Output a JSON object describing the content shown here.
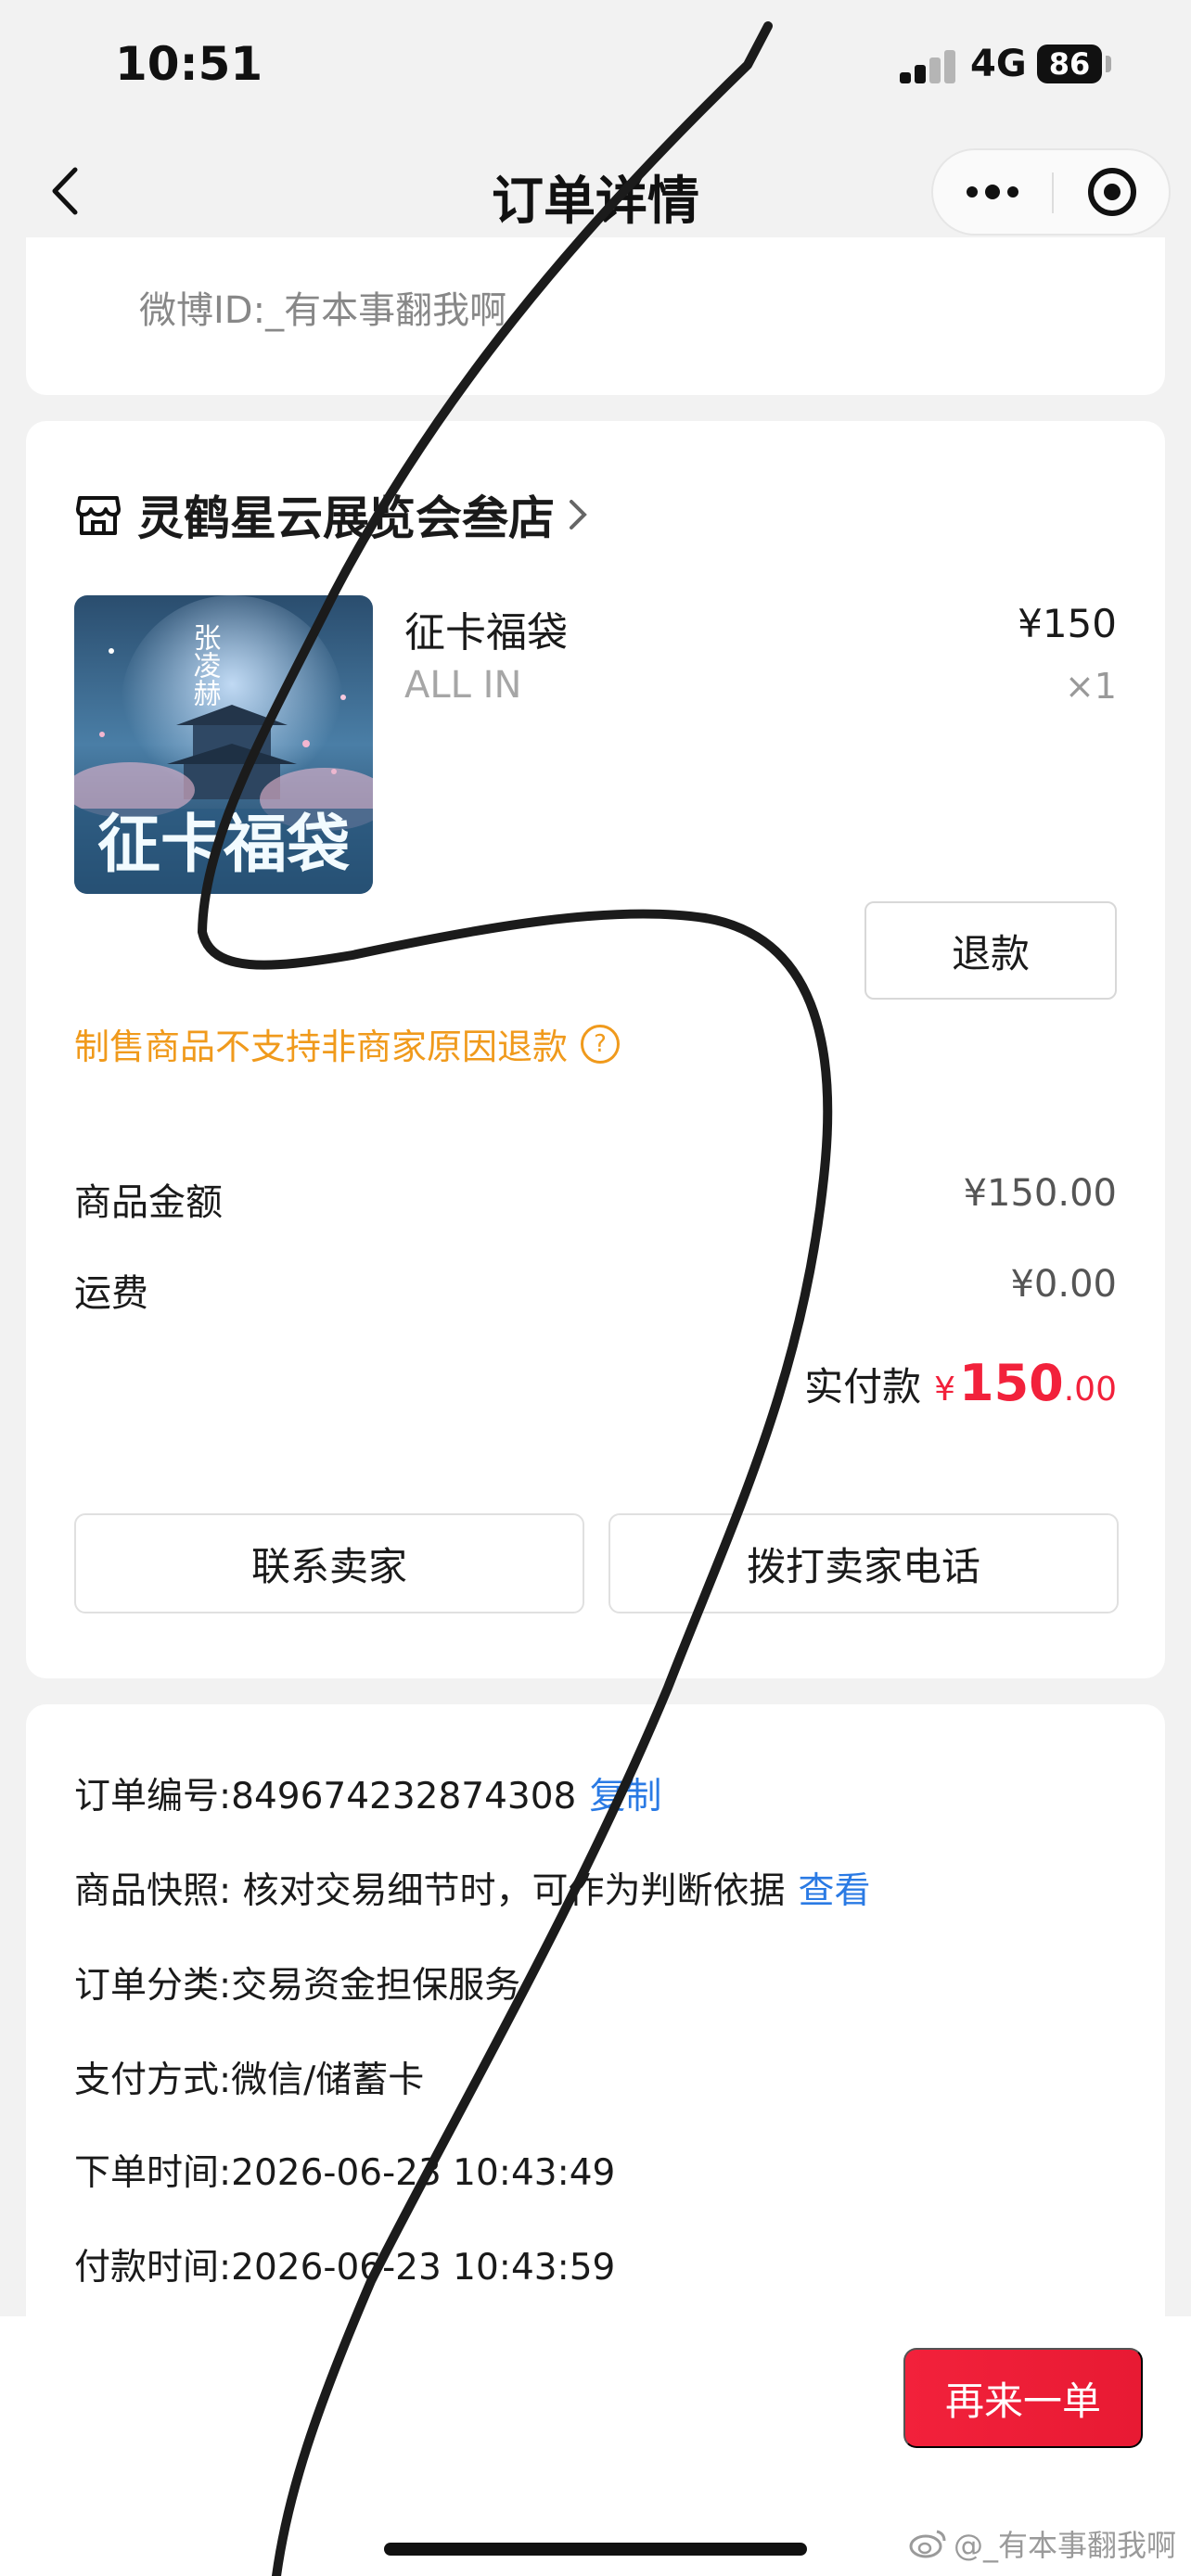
{
  "status_bar": {
    "time": "10:51",
    "network": "4G",
    "battery": "86"
  },
  "nav": {
    "title": "订单详情",
    "back_icon": "chevron-left-icon",
    "more_icon": "more-dots-icon",
    "close_icon": "target-close-icon"
  },
  "buyer": {
    "weibo_id": "微博ID:_有本事翻我啊"
  },
  "shop": {
    "name": "灵鹤星云展览会叁店",
    "icon": "store-icon"
  },
  "product": {
    "name": "征卡福袋",
    "sku": "ALL IN",
    "price": "¥150",
    "quantity": "×1",
    "image_text_main": "征卡福袋",
    "image_text_vertical": "张凌赫",
    "refund_label": "退款",
    "notice": "制售商品不支持非商家原因退款",
    "help_icon": "question-circle-icon"
  },
  "fees": {
    "goods_label": "商品金额",
    "goods_value": "¥150.00",
    "shipping_label": "运费",
    "shipping_value": "¥0.00",
    "paid_label": "实付款",
    "paid_currency": "¥",
    "paid_integer": "150",
    "paid_decimal": ".00"
  },
  "actions": {
    "contact_seller": "联系卖家",
    "call_seller": "拨打卖家电话"
  },
  "order_info": {
    "order_no": "订单编号:849674232874308",
    "copy": "复制",
    "snapshot": "商品快照: 核对交易细节时，可作为判断依据",
    "snapshot_link": "查看",
    "category": "订单分类:交易资金担保服务",
    "payment": "支付方式:微信/储蓄卡",
    "order_time": "下单时间:2026-06-23 10:43:49",
    "pay_time": "付款时间:2026-06-23 10:43:59"
  },
  "bottom": {
    "reorder": "再来一单",
    "watermark": "@_有本事翻我啊"
  },
  "colors": {
    "accent_red": "#f2213b",
    "notice_orange": "#f09a1c",
    "link_blue": "#2a7ae4"
  }
}
